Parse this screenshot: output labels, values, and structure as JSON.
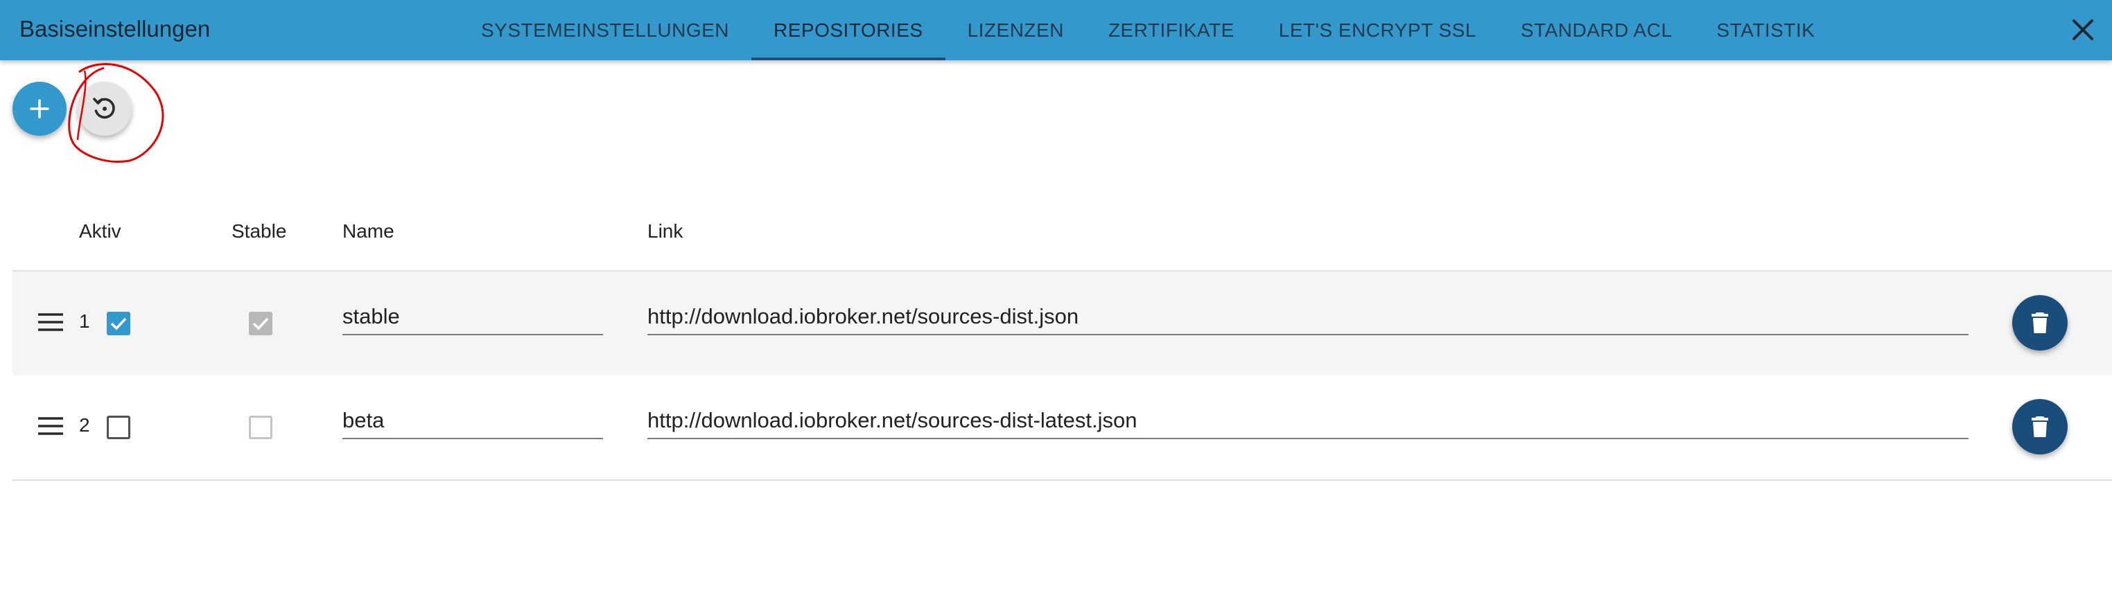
{
  "header": {
    "title": "Basiseinstellungen",
    "tabs": [
      {
        "label": "SYSTEMEINSTELLUNGEN"
      },
      {
        "label": "REPOSITORIES",
        "active": true
      },
      {
        "label": "LIZENZEN"
      },
      {
        "label": "ZERTIFIKATE"
      },
      {
        "label": "LET'S ENCRYPT SSL"
      },
      {
        "label": "STANDARD ACL"
      },
      {
        "label": "STATISTIK"
      }
    ],
    "close_icon": "close-icon"
  },
  "toolbar": {
    "add_icon": "plus-icon",
    "restore_icon": "restore-icon"
  },
  "table": {
    "columns": {
      "aktiv": "Aktiv",
      "stable": "Stable",
      "name": "Name",
      "link": "Link"
    },
    "rows": [
      {
        "index": "1",
        "aktiv": true,
        "stable": true,
        "name": "stable",
        "link": "http://download.iobroker.net/sources-dist.json"
      },
      {
        "index": "2",
        "aktiv": false,
        "stable": false,
        "name": "beta",
        "link": "http://download.iobroker.net/sources-dist-latest.json"
      }
    ]
  },
  "colors": {
    "appbar": "#3399cc",
    "accent": "#3399cc",
    "delete_button": "#1b4d7b",
    "annotation": "#e60000"
  }
}
